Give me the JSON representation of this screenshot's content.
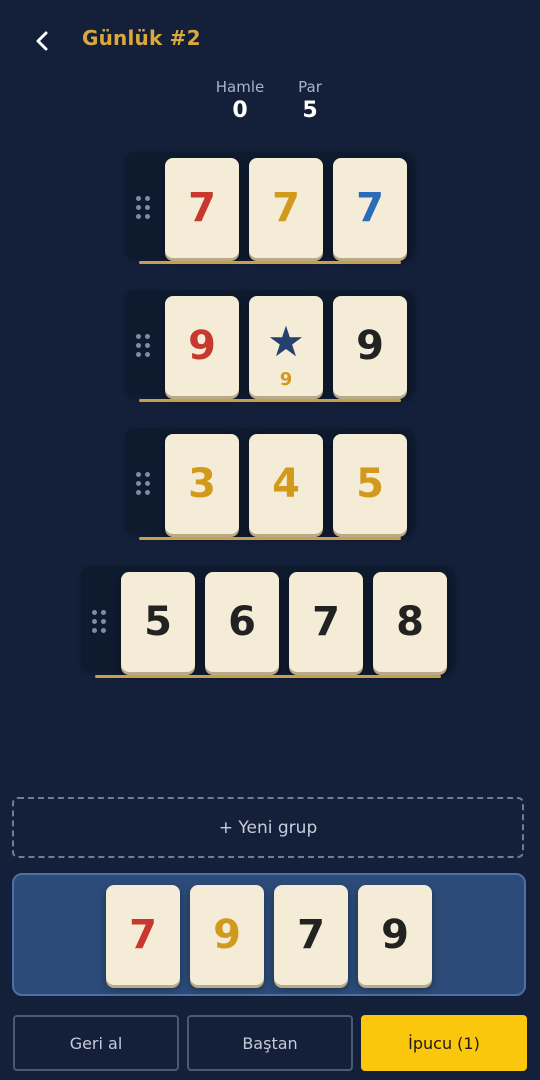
{
  "header": {
    "title": "Günlük #2"
  },
  "stats": {
    "moves_label": "Hamle",
    "moves_value": "0",
    "par_label": "Par",
    "par_value": "5"
  },
  "groups": [
    {
      "tiles": [
        {
          "v": "7",
          "color": "#c8382e"
        },
        {
          "v": "7",
          "color": "#d19a1c"
        },
        {
          "v": "7",
          "color": "#2a6cb8"
        }
      ]
    },
    {
      "tiles": [
        {
          "v": "9",
          "color": "#c8382e"
        },
        {
          "v": "★",
          "color": "#26406e",
          "sub": "9",
          "sub_color": "#d19a1c"
        },
        {
          "v": "9",
          "color": "#222222"
        }
      ]
    },
    {
      "tiles": [
        {
          "v": "3",
          "color": "#d19a1c"
        },
        {
          "v": "4",
          "color": "#d19a1c"
        },
        {
          "v": "5",
          "color": "#d19a1c"
        }
      ]
    },
    {
      "tiles": [
        {
          "v": "5",
          "color": "#222222"
        },
        {
          "v": "6",
          "color": "#222222"
        },
        {
          "v": "7",
          "color": "#222222"
        },
        {
          "v": "8",
          "color": "#222222"
        }
      ]
    }
  ],
  "new_group_label": "+ Yeni grup",
  "rack": [
    {
      "v": "7",
      "color": "#c8382e"
    },
    {
      "v": "9",
      "color": "#d19a1c"
    },
    {
      "v": "7",
      "color": "#222222"
    },
    {
      "v": "9",
      "color": "#222222"
    }
  ],
  "buttons": {
    "undo": "Geri al",
    "restart": "Baştan",
    "hint": "İpucu (1)"
  },
  "colors": {
    "background": "#14203a",
    "accent": "#d9a93e",
    "hint_button": "#fbc70c"
  }
}
